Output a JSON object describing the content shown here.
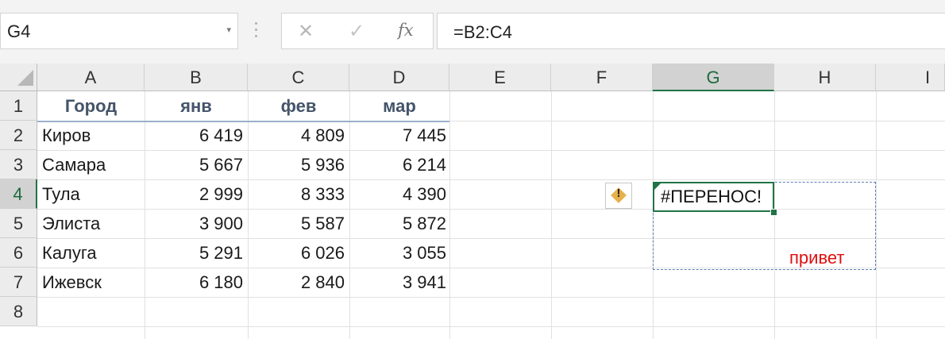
{
  "formula_bar": {
    "name_box": "G4",
    "cancel_icon": "✕",
    "enter_icon": "✓",
    "fx_label": "fx",
    "formula": "=B2:C4"
  },
  "columns": [
    "A",
    "B",
    "C",
    "D",
    "E",
    "F",
    "G",
    "H",
    "I"
  ],
  "rows": [
    "1",
    "2",
    "3",
    "4",
    "5",
    "6",
    "7",
    "8"
  ],
  "table": {
    "headers": [
      "Город",
      "янв",
      "фев",
      "мар"
    ],
    "rows": [
      [
        "Киров",
        "6 419",
        "4 809",
        "7 445"
      ],
      [
        "Самара",
        "5 667",
        "5 936",
        "6 214"
      ],
      [
        "Тула",
        "2 999",
        "8 333",
        "4 390"
      ],
      [
        "Элиста",
        "3 900",
        "5 587",
        "5 872"
      ],
      [
        "Калуга",
        "5 291",
        "6 026",
        "3 055"
      ],
      [
        "Ижевск",
        "6 180",
        "2 840",
        "3 941"
      ]
    ]
  },
  "active_cell": {
    "ref": "G4",
    "value": "#ПЕРЕНОС!",
    "column": "G",
    "row": "4"
  },
  "error_button": {
    "icon": "warning-diamond-icon",
    "mark": "!"
  },
  "obstructing_cell": {
    "ref": "H6",
    "value": "привет"
  },
  "colors": {
    "accent_green": "#217346",
    "header_text": "#44546a",
    "error_text": "#e01010",
    "spill_border": "#5b7fb5"
  }
}
